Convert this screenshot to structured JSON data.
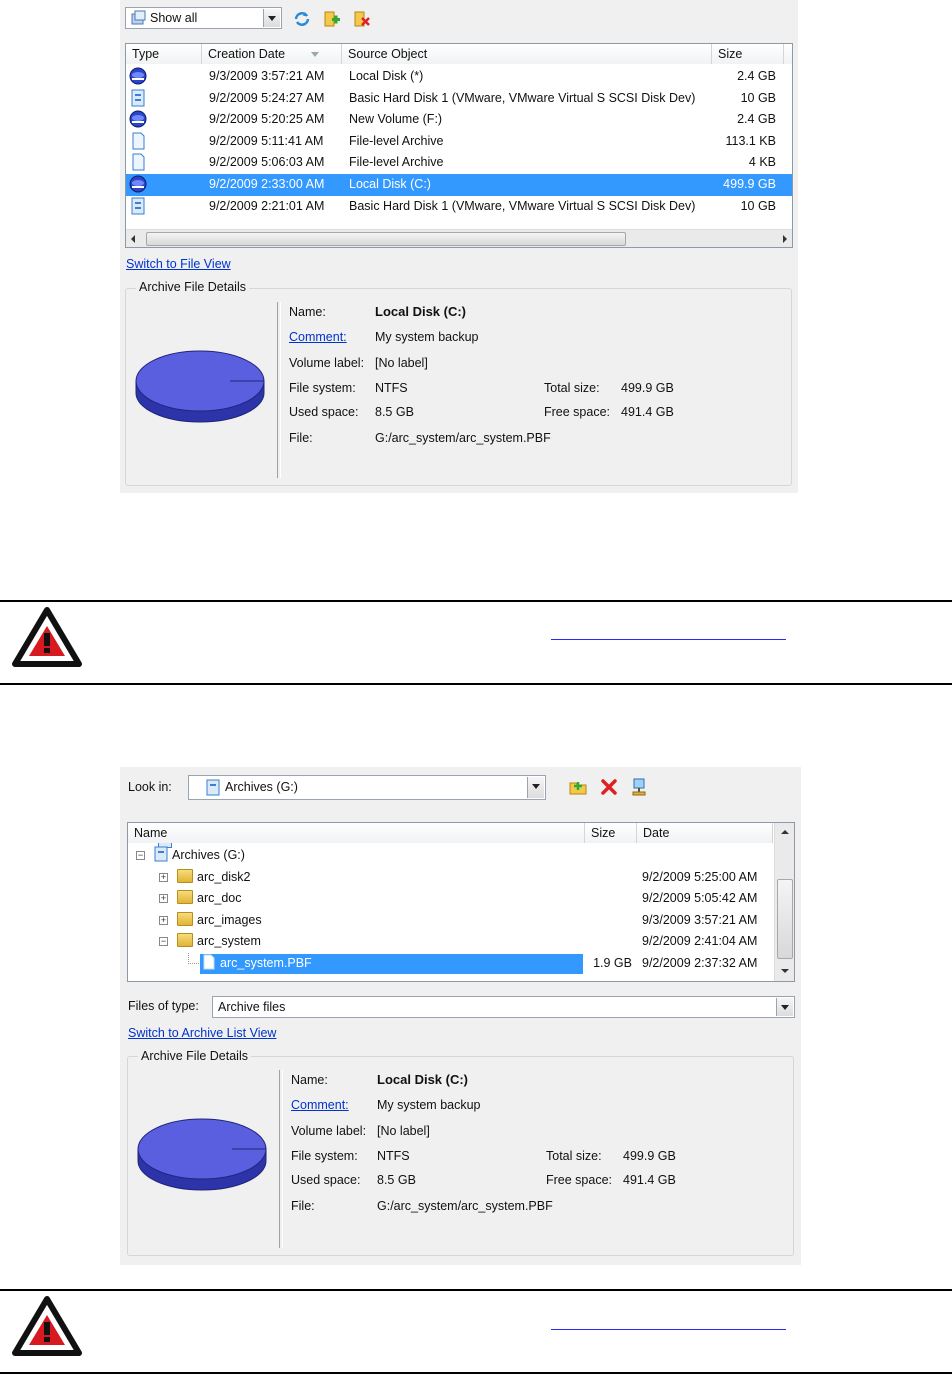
{
  "panel1": {
    "filter_combo": {
      "value": "Show all"
    },
    "columns": [
      "Type",
      "Creation Date",
      "Source Object",
      "Size"
    ],
    "rows": [
      {
        "date": "9/3/2009 3:57:21 AM",
        "source": "Local Disk (*)",
        "size": "2.4 GB",
        "icon": "volume-icon"
      },
      {
        "date": "9/2/2009 5:24:27 AM",
        "source": "Basic Hard Disk 1 (VMware, VMware Virtual S SCSI Disk Dev)",
        "size": "10 GB",
        "icon": "disk-icon"
      },
      {
        "date": "9/2/2009 5:20:25 AM",
        "source": "New Volume (F:)",
        "size": "2.4 GB",
        "icon": "volume-icon"
      },
      {
        "date": "9/2/2009 5:11:41 AM",
        "source": "File-level Archive",
        "size": "113.1 KB",
        "icon": "file-icon"
      },
      {
        "date": "9/2/2009 5:06:03 AM",
        "source": "File-level Archive",
        "size": "4 KB",
        "icon": "file-icon"
      },
      {
        "date": "9/2/2009 2:33:00 AM",
        "source": "Local Disk (C:)",
        "size": "499.9 GB",
        "icon": "volume-icon",
        "selected": true
      },
      {
        "date": "9/2/2009 2:21:01 AM",
        "source": "Basic Hard Disk 1 (VMware, VMware Virtual S SCSI Disk Dev)",
        "size": "10 GB",
        "icon": "disk-icon"
      }
    ],
    "switch_link": "Switch to File View",
    "details_title": "Archive File Details",
    "details": {
      "name_label": "Name:",
      "name_value": "Local Disk (C:)",
      "comment_label": "Comment:",
      "comment_value": "My system backup",
      "volume_label": "Volume label:",
      "volume_value": "[No label]",
      "fs_label": "File system:",
      "fs_value": "NTFS",
      "total_label": "Total size:",
      "total_value": "499.9 GB",
      "used_label": "Used space:",
      "used_value": "8.5 GB",
      "free_label": "Free space:",
      "free_value": "491.4 GB",
      "file_label": "File:",
      "file_value": "G:/arc_system/arc_system.PBF"
    }
  },
  "panel2": {
    "look_in_label": "Look in:",
    "look_in_value": "Archives (G:)",
    "columns": [
      "Name",
      "Size",
      "Date"
    ],
    "tree": [
      {
        "label": "Archives (G:)",
        "date": "",
        "size": ""
      },
      {
        "label": "arc_disk2",
        "date": "9/2/2009 5:25:00 AM",
        "size": ""
      },
      {
        "label": "arc_doc",
        "date": "9/2/2009 5:05:42 AM",
        "size": ""
      },
      {
        "label": "arc_images",
        "date": "9/3/2009 3:57:21 AM",
        "size": ""
      },
      {
        "label": "arc_system",
        "date": "9/2/2009 2:41:04 AM",
        "size": ""
      },
      {
        "label": "arc_system.PBF",
        "date": "9/2/2009 2:37:32 AM",
        "size": "1.9 GB",
        "selected": true
      }
    ],
    "files_of_type_label": "Files of type:",
    "files_of_type_value": "Archive files",
    "switch_link": "Switch to Archive List View",
    "details_title": "Archive File Details",
    "details": {
      "name_label": "Name:",
      "name_value": "Local Disk (C:)",
      "comment_label": "Comment:",
      "comment_value": "My system backup",
      "volume_label": "Volume label:",
      "volume_value": "[No label]",
      "fs_label": "File system:",
      "fs_value": "NTFS",
      "total_label": "Total size:",
      "total_value": "499.9 GB",
      "used_label": "Used space:",
      "used_value": "8.5 GB",
      "free_label": "Free space:",
      "free_value": "491.4 GB",
      "file_label": "File:",
      "file_value": "G:/arc_system/arc_system.PBF"
    }
  },
  "colors": {
    "selection": "#3399ff",
    "link": "#0033cc",
    "disk_fill": "#5a5fe0",
    "warning_red": "#d71920"
  }
}
